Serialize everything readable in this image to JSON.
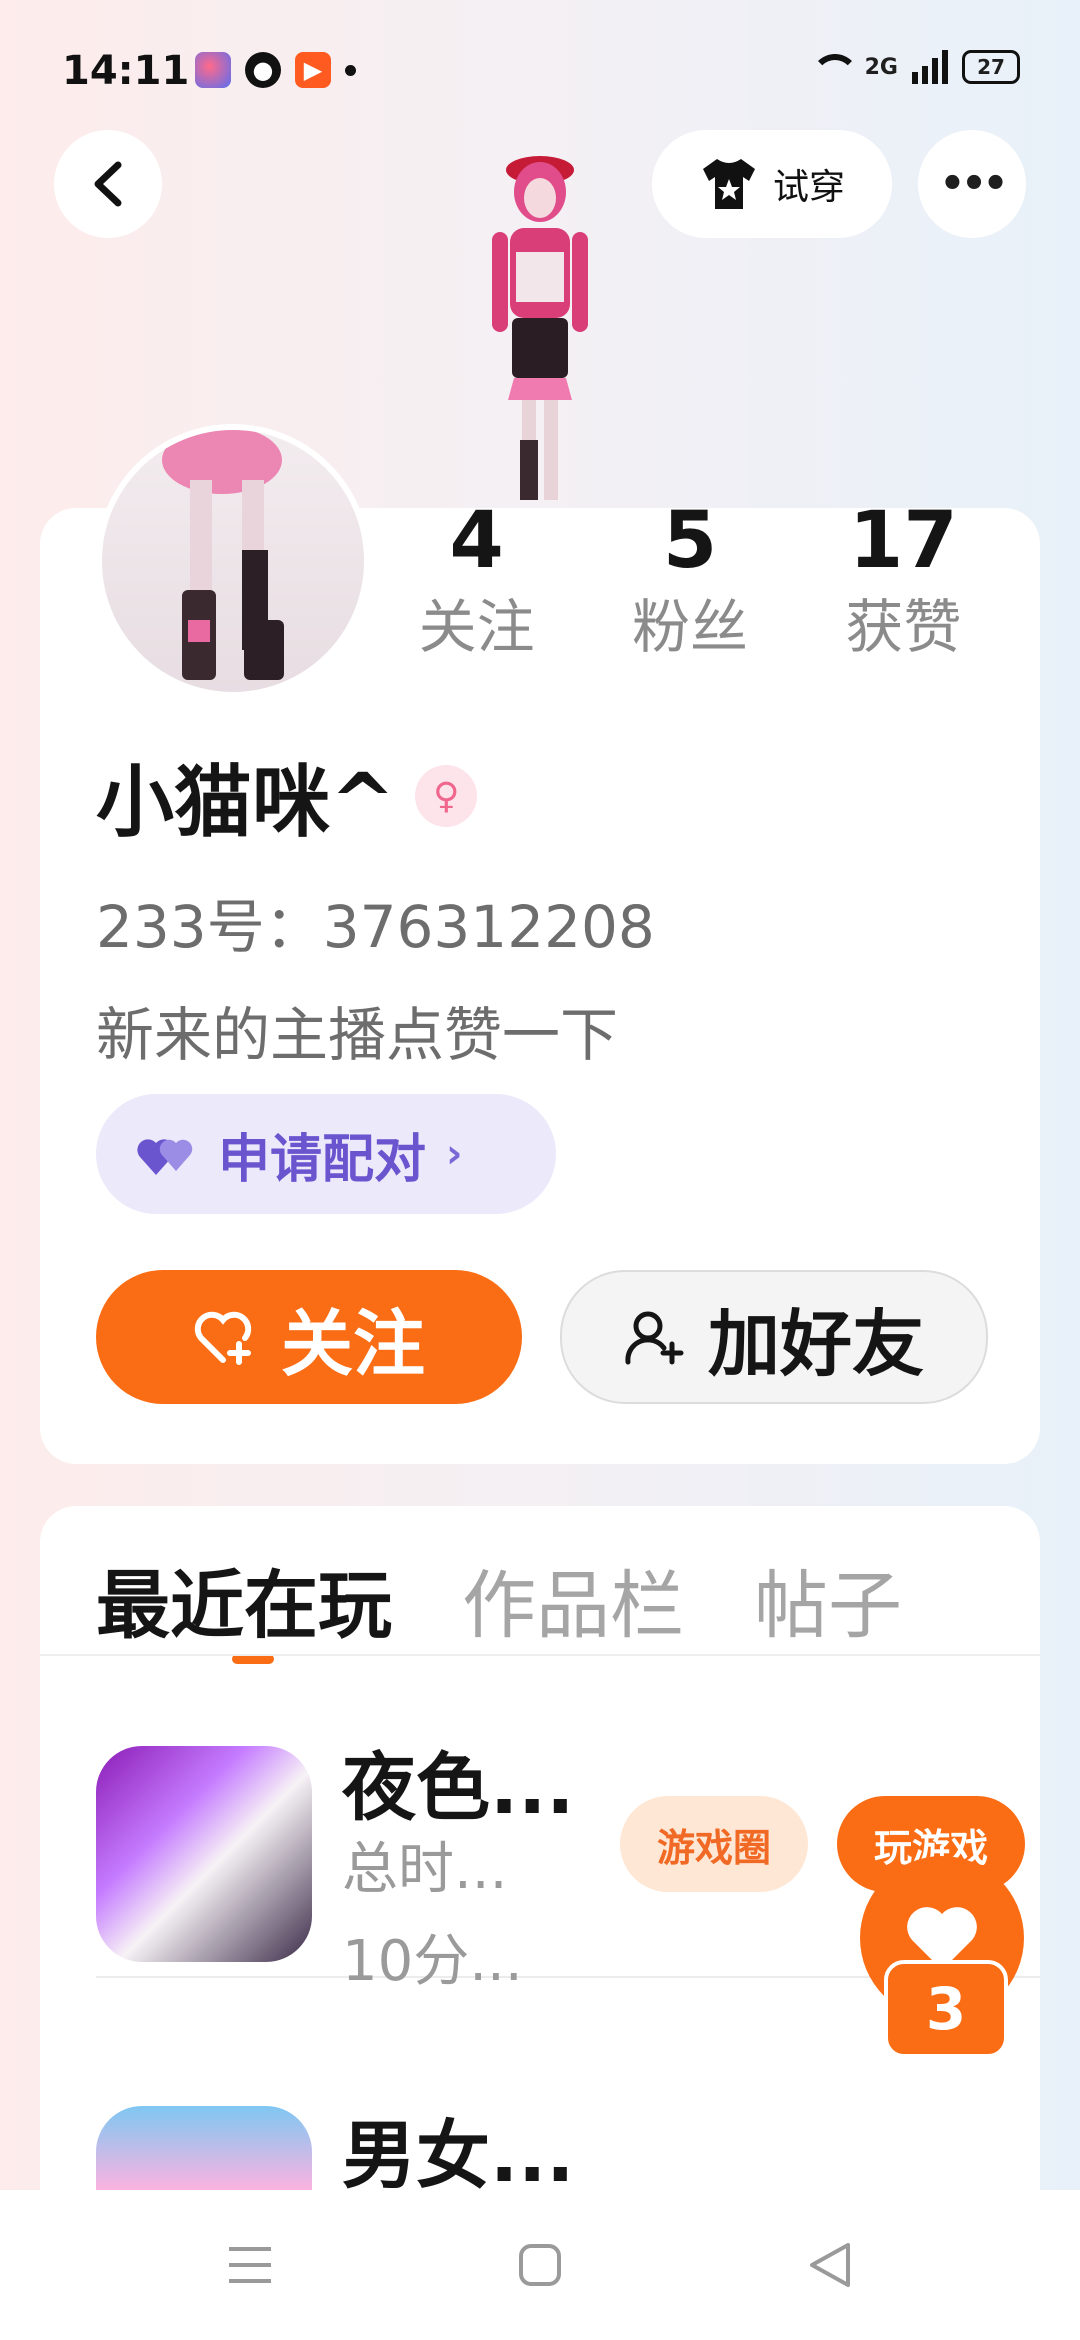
{
  "status_bar": {
    "time": "14:11",
    "network": "2G",
    "battery": "27"
  },
  "header": {
    "try_on_label": "试穿"
  },
  "profile": {
    "stats": [
      {
        "value": "4",
        "label": "关注"
      },
      {
        "value": "5",
        "label": "粉丝"
      },
      {
        "value": "17",
        "label": "获赞"
      }
    ],
    "name": "小猫咪^",
    "id_text": "233号：376312208",
    "bio": "新来的主播点赞一下",
    "pair_label": "申请配对",
    "follow_label": "关注",
    "add_friend_label": "加好友"
  },
  "tabs": [
    "最近在玩",
    "作品栏",
    "帖子"
  ],
  "games": [
    {
      "title": "夜色...",
      "line1": "总时...",
      "line2": "10分...",
      "circle_label": "游戏圈",
      "play_label": "玩游戏"
    },
    {
      "title": "男女...",
      "line1": "",
      "line2": "",
      "circle_label": "",
      "play_label": ""
    }
  ],
  "floating_like": {
    "count": "3"
  },
  "colors": {
    "accent": "#fa6d14",
    "pair_bg": "#ece9fb",
    "pair_text": "#6a55cf"
  }
}
